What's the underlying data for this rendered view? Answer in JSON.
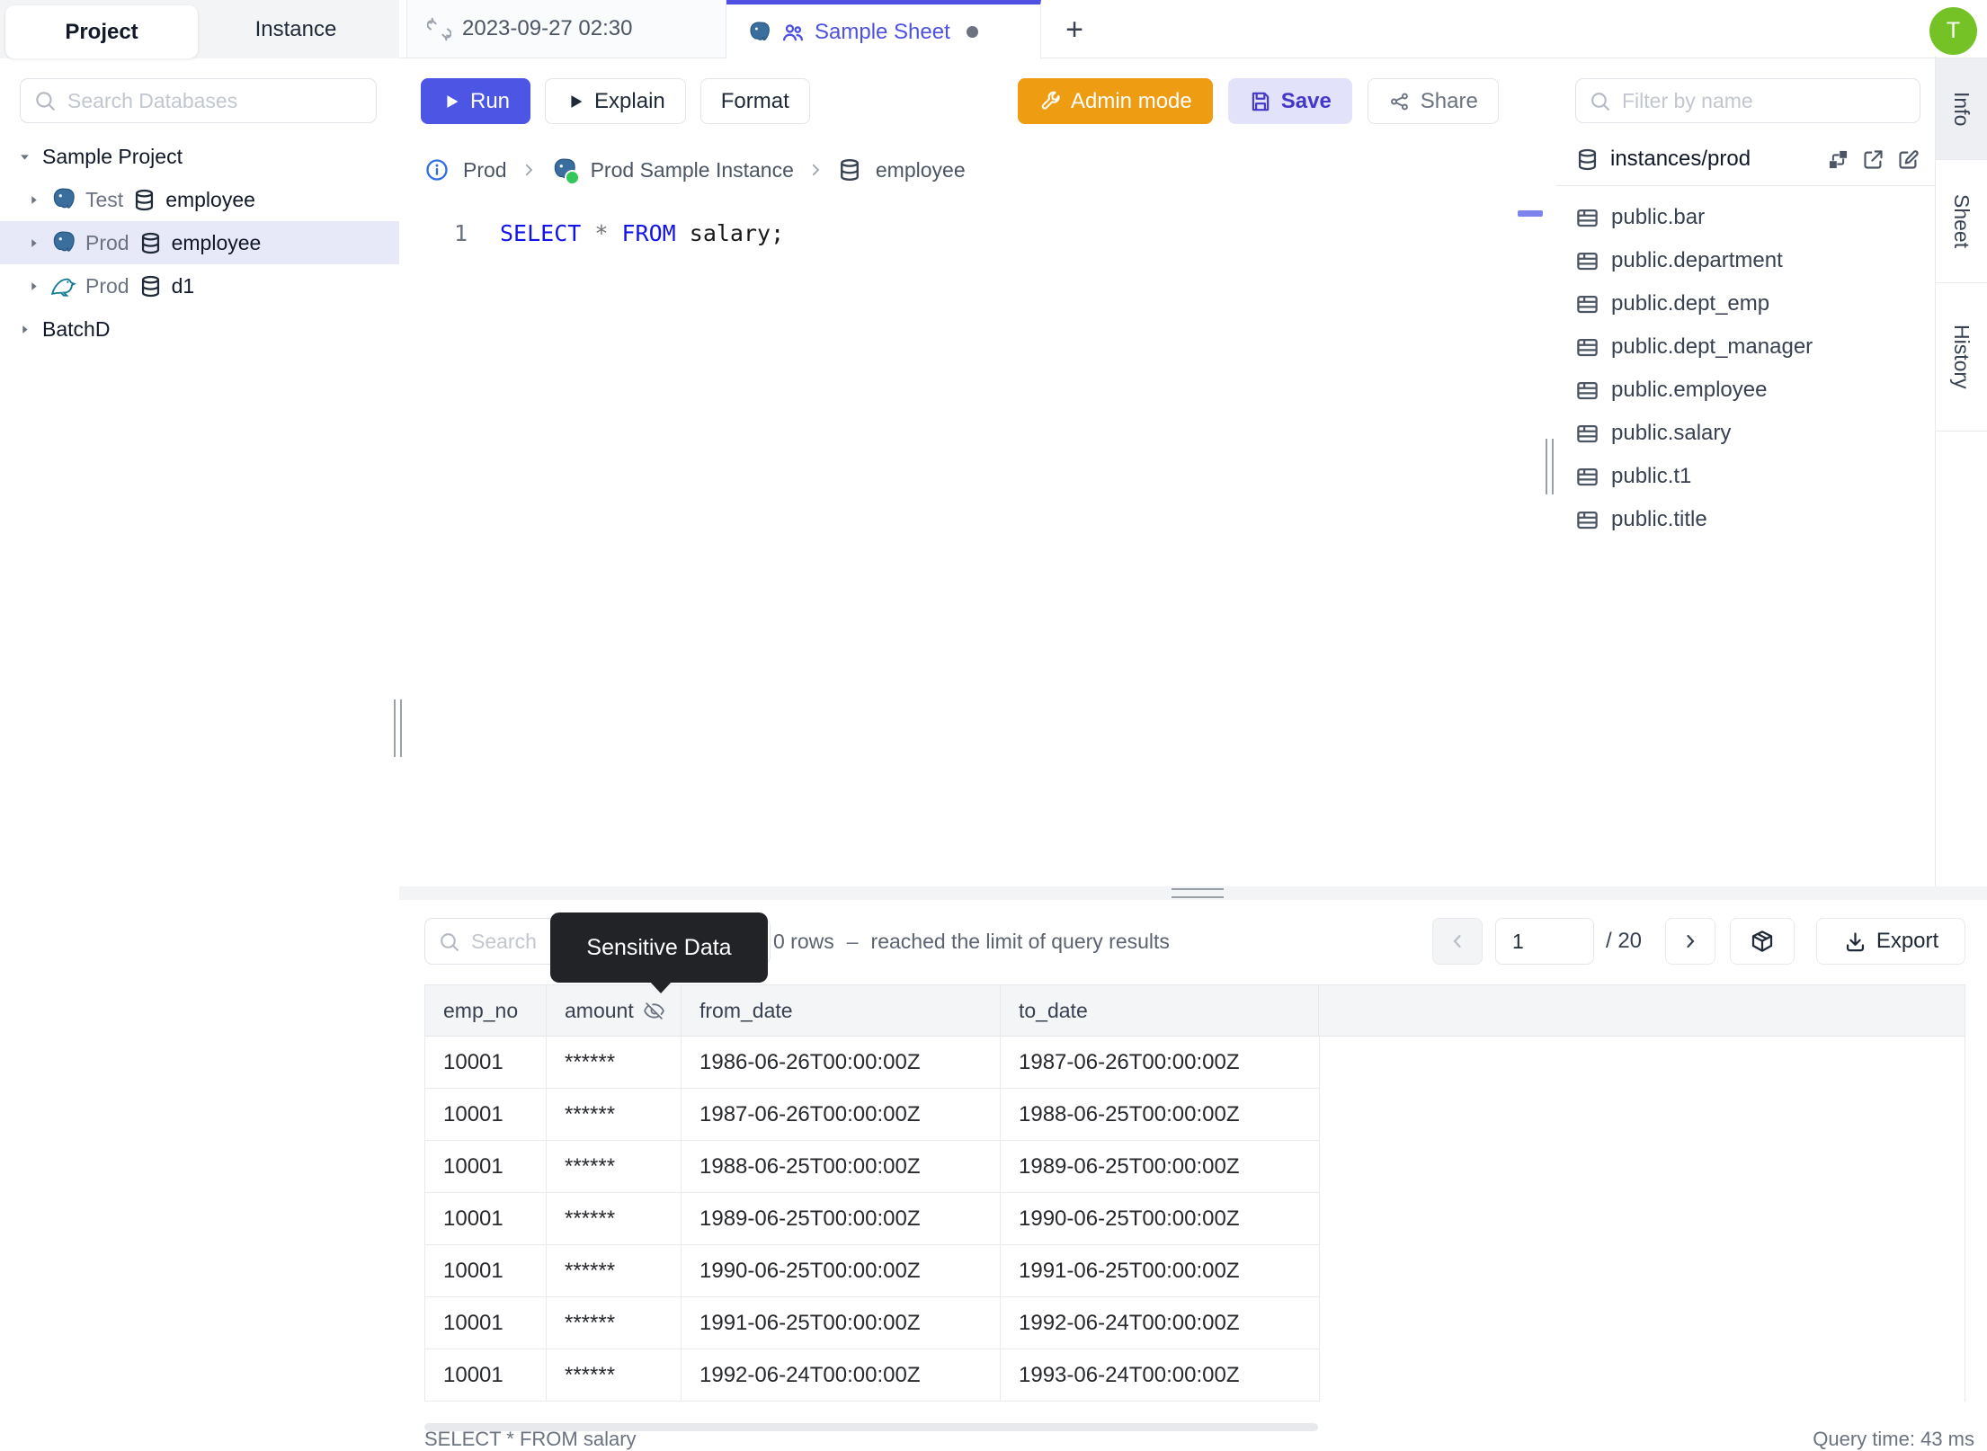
{
  "colors": {
    "accent": "#4d55e5",
    "active_tab": "#4d50e0",
    "admin_orange": "#ee9d13",
    "save_bg": "#e3e2fb",
    "avatar_green": "#74c226",
    "selection_bg": "#e7e9f8",
    "keyword_blue": "#1414e8",
    "tooltip_bg": "#212327"
  },
  "left_sidebar": {
    "tabs": [
      {
        "label": "Project",
        "active": true
      },
      {
        "label": "Instance",
        "active": false
      }
    ],
    "search_placeholder": "Search Databases",
    "tree": [
      {
        "type": "project",
        "caret": "down",
        "label": "Sample Project"
      },
      {
        "type": "db",
        "caret": "right",
        "engine": "postgres",
        "env": "Test",
        "name": "employee"
      },
      {
        "type": "db",
        "caret": "right",
        "engine": "postgres",
        "env": "Prod",
        "name": "employee",
        "selected": true
      },
      {
        "type": "db",
        "caret": "right",
        "engine": "mysql",
        "env": "Prod",
        "name": "d1"
      },
      {
        "type": "project",
        "caret": "right",
        "label": "BatchD"
      }
    ]
  },
  "editor_tabs": {
    "tab1_label": "2023-09-27 02:30",
    "tab2_label": "Sample Sheet",
    "add_label": "+"
  },
  "toolbar": {
    "run": "Run",
    "explain": "Explain",
    "format": "Format",
    "admin_mode": "Admin mode",
    "save": "Save",
    "share": "Share"
  },
  "breadcrumb": {
    "environment": "Prod",
    "instance": "Prod Sample Instance",
    "database": "employee"
  },
  "sql_editor": {
    "line_number": "1",
    "kw1": "SELECT",
    "star": "*",
    "kw2": "FROM",
    "rest": "salary;"
  },
  "right_panel": {
    "filter_placeholder": "Filter by name",
    "schema_source": "instances/prod",
    "tables": [
      "public.bar",
      "public.department",
      "public.dept_emp",
      "public.dept_manager",
      "public.employee",
      "public.salary",
      "public.t1",
      "public.title"
    ]
  },
  "side_tabs": [
    {
      "label": "Info",
      "active": true
    },
    {
      "label": "Sheet",
      "active": false
    },
    {
      "label": "History",
      "active": false
    }
  ],
  "results": {
    "search_placeholder": "Search",
    "tooltip": "Sensitive Data",
    "row_count": "0 rows",
    "separator": "–",
    "limit_note": "reached the limit of query results",
    "pagination": {
      "page": "1",
      "total": "/ 20"
    },
    "export_label": "Export",
    "table": {
      "columns": [
        {
          "label": "emp_no"
        },
        {
          "label": "amount",
          "masked": true
        },
        {
          "label": "from_date"
        },
        {
          "label": "to_date"
        },
        {
          "label": ""
        }
      ],
      "rows": [
        [
          "10001",
          "******",
          "1986-06-26T00:00:00Z",
          "1987-06-26T00:00:00Z"
        ],
        [
          "10001",
          "******",
          "1987-06-26T00:00:00Z",
          "1988-06-25T00:00:00Z"
        ],
        [
          "10001",
          "******",
          "1988-06-25T00:00:00Z",
          "1989-06-25T00:00:00Z"
        ],
        [
          "10001",
          "******",
          "1989-06-25T00:00:00Z",
          "1990-06-25T00:00:00Z"
        ],
        [
          "10001",
          "******",
          "1990-06-25T00:00:00Z",
          "1991-06-25T00:00:00Z"
        ],
        [
          "10001",
          "******",
          "1991-06-25T00:00:00Z",
          "1992-06-24T00:00:00Z"
        ],
        [
          "10001",
          "******",
          "1992-06-24T00:00:00Z",
          "1993-06-24T00:00:00Z"
        ]
      ]
    },
    "status_query": "SELECT * FROM salary",
    "status_time": "Query time: 43 ms"
  },
  "user": {
    "initial": "T"
  }
}
